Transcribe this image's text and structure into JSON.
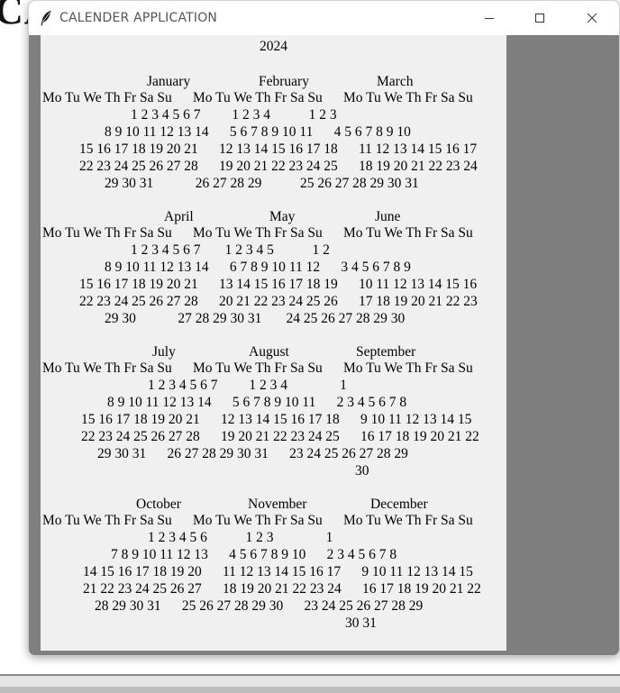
{
  "background": {
    "partial_title": "CA",
    "color": "#111111"
  },
  "window": {
    "title": "CALENDER APPLICATION",
    "icon": "feather-icon",
    "controls": {
      "minimize": "minimize-icon",
      "maximize": "maximize-icon",
      "close": "close-icon"
    },
    "colors": {
      "titlebar": "#ffffff",
      "client_bg": "#7f7f7f",
      "calendar_bg": "#f0f0f0"
    }
  },
  "calendar": {
    "year": "2024",
    "quarters": [
      {
        "months": [
          "January",
          "February",
          "March"
        ],
        "dow": "Mo Tu We Th Fr Sa Su      Mo Tu We Th Fr Sa Su      Mo Tu We Th Fr Sa Su",
        "weeks": [
          "1 2 3 4 5 6 7         1 2 3 4           1 2 3",
          "8 9 10 11 12 13 14      5 6 7 8 9 10 11      4 5 6 7 8 9 10",
          "15 16 17 18 19 20 21      12 13 14 15 16 17 18      11 12 13 14 15 16 17",
          "22 23 24 25 26 27 28      19 20 21 22 23 24 25      18 19 20 21 22 23 24",
          "29 30 31            26 27 28 29           25 26 27 28 29 30 31"
        ]
      },
      {
        "months": [
          "April",
          "May",
          "June"
        ],
        "dow": "Mo Tu We Th Fr Sa Su      Mo Tu We Th Fr Sa Su      Mo Tu We Th Fr Sa Su",
        "weeks": [
          "1 2 3 4 5 6 7       1 2 3 4 5           1 2",
          "8 9 10 11 12 13 14      6 7 8 9 10 11 12      3 4 5 6 7 8 9",
          "15 16 17 18 19 20 21      13 14 15 16 17 18 19      10 11 12 13 14 15 16",
          "22 23 24 25 26 27 28      20 21 22 23 24 25 26      17 18 19 20 21 22 23",
          "29 30            27 28 29 30 31       24 25 26 27 28 29 30"
        ]
      },
      {
        "months": [
          "July",
          "August",
          "September"
        ],
        "dow": "Mo Tu We Th Fr Sa Su      Mo Tu We Th Fr Sa Su      Mo Tu We Th Fr Sa Su",
        "weeks": [
          "1 2 3 4 5 6 7         1 2 3 4               1",
          "8 9 10 11 12 13 14      5 6 7 8 9 10 11      2 3 4 5 6 7 8",
          "15 16 17 18 19 20 21      12 13 14 15 16 17 18      9 10 11 12 13 14 15",
          "22 23 24 25 26 27 28      19 20 21 22 23 24 25      16 17 18 19 20 21 22",
          "29 30 31      26 27 28 29 30 31      23 24 25 26 27 28 29",
          "30"
        ]
      },
      {
        "months": [
          "October",
          "November",
          "December"
        ],
        "dow": "Mo Tu We Th Fr Sa Su      Mo Tu We Th Fr Sa Su      Mo Tu We Th Fr Sa Su",
        "weeks": [
          "1 2 3 4 5 6           1 2 3               1",
          "7 8 9 10 11 12 13      4 5 6 7 8 9 10      2 3 4 5 6 7 8",
          "14 15 16 17 18 19 20      11 12 13 14 15 16 17      9 10 11 12 13 14 15",
          "21 22 23 24 25 26 27      18 19 20 21 22 23 24      16 17 18 19 20 21 22",
          "28 29 30 31      25 26 27 28 29 30      23 24 25 26 27 28 29",
          "30 31"
        ]
      }
    ]
  }
}
